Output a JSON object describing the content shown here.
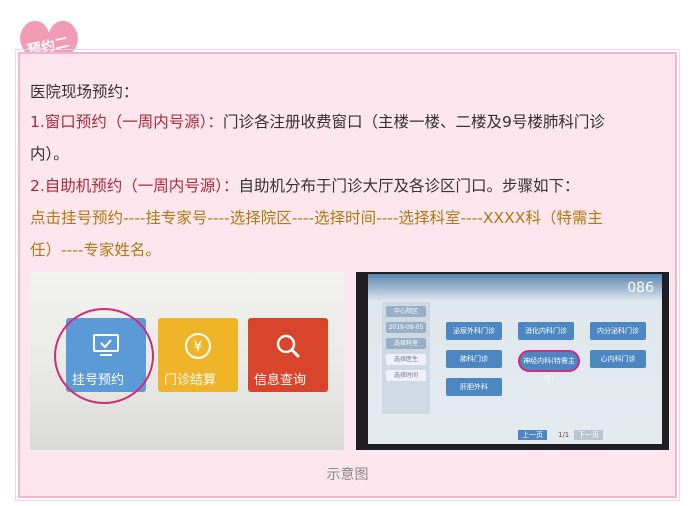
{
  "badge": {
    "label": "预约二"
  },
  "intro": {
    "title": "医院现场预约："
  },
  "item1": {
    "heading": "1.窗口预约（一周内号源）：",
    "line1": "门诊各注册收费窗口（主楼一楼、二楼及9号楼肺科门诊",
    "line2": "内）。"
  },
  "item2": {
    "heading": "2.自助机预约（一周内号源）：",
    "text": "自助机分布于门诊大厅及各诊区门口。步骤如下："
  },
  "steps": {
    "line1": "点击挂号预约----挂专家号----选择院区----选择时间----选择科室----XXXX科（特需主",
    "line2": "任）----专家姓名。"
  },
  "kiosk_left": {
    "tiles": [
      {
        "label": "挂号预约",
        "icon": "monitor-icon",
        "color": "#5b9ad6"
      },
      {
        "label": "门诊结算",
        "icon": "yen-icon",
        "color": "#f0b429"
      },
      {
        "label": "信息查询",
        "icon": "magnifier-icon",
        "color": "#d9452b"
      }
    ]
  },
  "kiosk_right": {
    "counter": "086",
    "side_items": [
      "中心院区",
      "2019-09-05",
      "选择科室",
      "选择医生",
      "选择时间"
    ],
    "departments": [
      "泌尿外科门诊",
      "消化内科门诊",
      "内分泌科门诊",
      "肺科门诊",
      "神经内科(特需主任)",
      "心内科门诊",
      "肝胆外科"
    ],
    "pager": {
      "prev": "上一页",
      "page": "1/1",
      "next": "下一页"
    }
  },
  "caption": "示意图",
  "colors": {
    "accent_red": "#b0283a",
    "accent_gold": "#b07a10",
    "card_bg": "#fde6ee",
    "highlight_ring": "#d12b7a"
  }
}
